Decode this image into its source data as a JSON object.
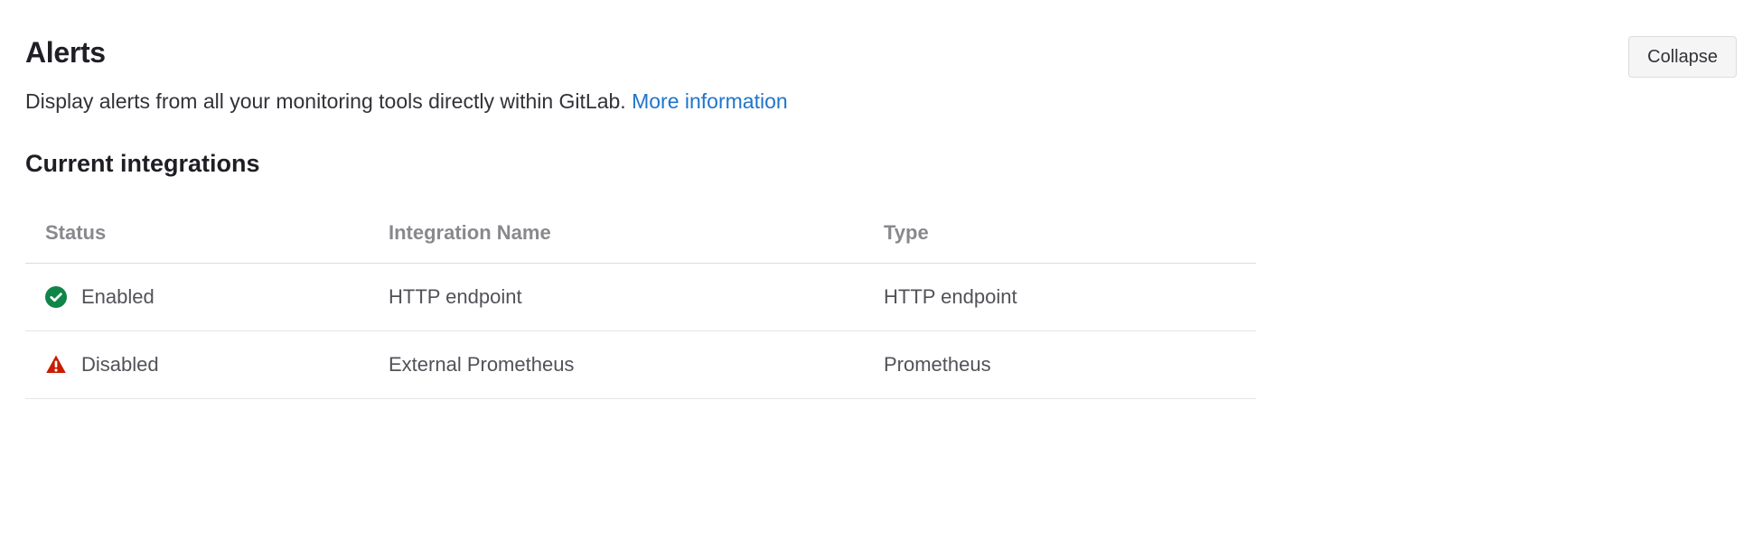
{
  "header": {
    "title": "Alerts",
    "collapse_label": "Collapse"
  },
  "description": {
    "text": "Display alerts from all your monitoring tools directly within GitLab. ",
    "link_text": "More information"
  },
  "section_heading": "Current integrations",
  "columns": {
    "status": "Status",
    "name": "Integration Name",
    "type": "Type"
  },
  "rows": [
    {
      "status": "enabled",
      "status_label": "Enabled",
      "name": "HTTP endpoint",
      "type": "HTTP endpoint"
    },
    {
      "status": "disabled",
      "status_label": "Disabled",
      "name": "External Prometheus",
      "type": "Prometheus"
    }
  ]
}
